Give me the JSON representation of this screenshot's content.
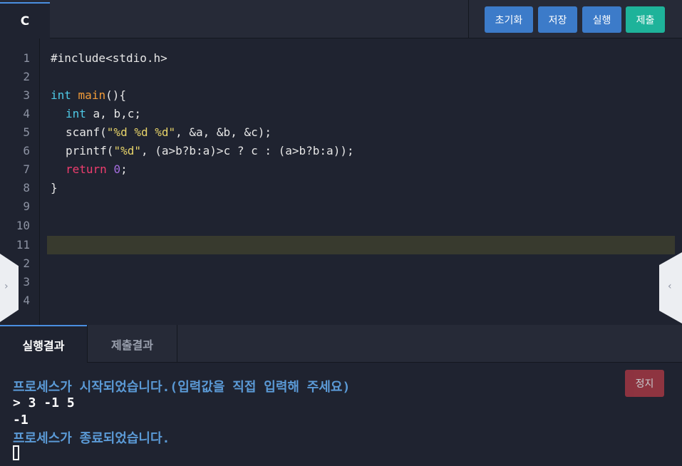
{
  "editor": {
    "language_tab": "C",
    "buttons": {
      "reset": "초기화",
      "save": "저장",
      "run": "실행",
      "submit": "제출"
    },
    "line_numbers": [
      "1",
      "2",
      "3",
      "4",
      "5",
      "6",
      "7",
      "8",
      "9",
      "10",
      "11",
      "2",
      "3",
      "4"
    ],
    "code": {
      "l1": "#include<stdio.h>",
      "l3_kw": "int",
      "l3_fn": "main",
      "l3_rest": "(){",
      "l4_kw": "int",
      "l4_rest": " a, b,c;",
      "l5_a": "scanf(",
      "l5_str": "\"%d %d %d\"",
      "l5_b": ", &a, &b, &c);",
      "l6_a": "printf(",
      "l6_str": "\"%d\"",
      "l6_b": ", (a>b?b:a)>c ? c : (a>b?b:a));",
      "l7_kw": "return",
      "l7_num": "0",
      "l7_rest": ";",
      "l8": "}"
    }
  },
  "side_arrows": {
    "left": "›",
    "right": "‹"
  },
  "result_tabs": {
    "run_result": "실행결과",
    "submit_result": "제출결과"
  },
  "console": {
    "stop_button": "정지",
    "lines": [
      "프로세스가 시작되었습니다.(입력값을 직접 입력해 주세요)",
      "> 3 -1 5",
      "-1",
      "프로세스가 종료되었습니다."
    ]
  },
  "colors": {
    "accent_blue": "#3c7bc9",
    "accent_teal": "#1eb39a",
    "stop_red": "#b33a46",
    "keyword": "#4ec9e6",
    "function": "#f29b38",
    "string": "#e8d46a",
    "return_kw": "#ef3d6e",
    "number": "#a46ddf"
  }
}
